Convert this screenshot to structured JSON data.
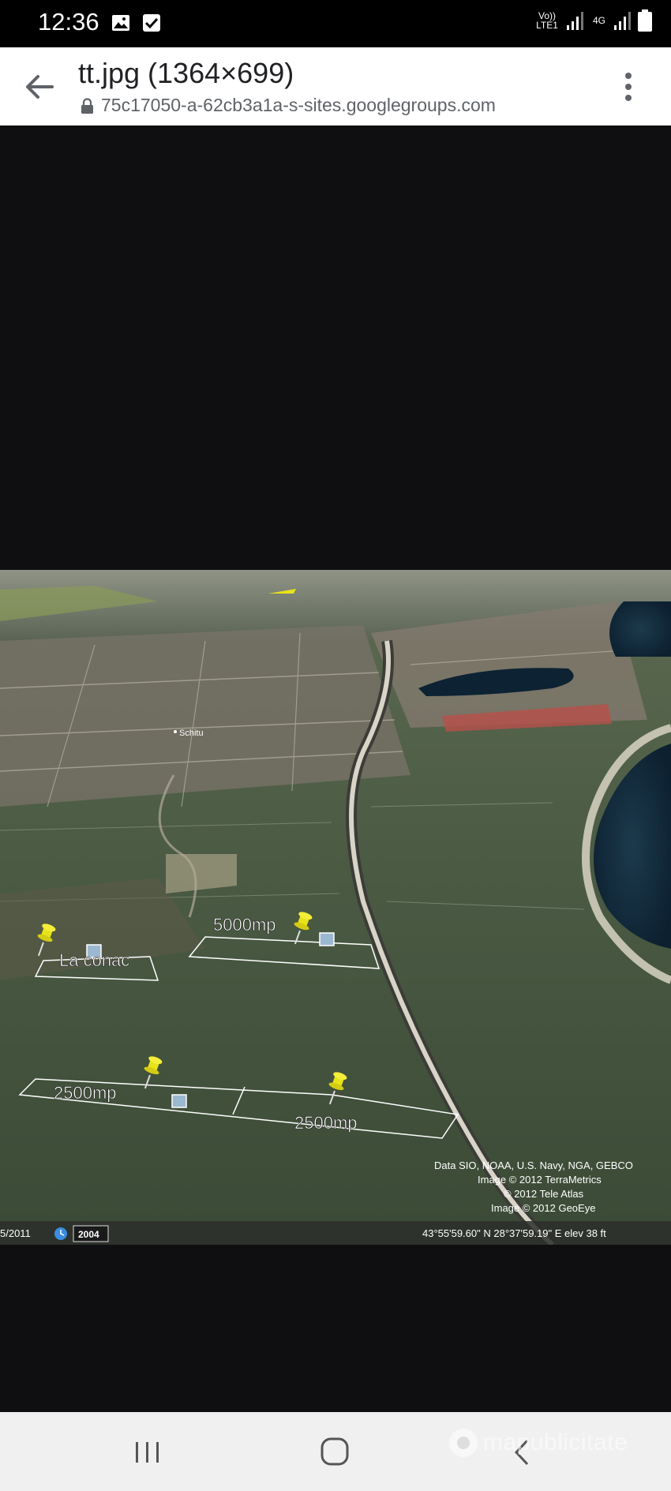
{
  "status_bar": {
    "time": "12:36",
    "network_primary": "Vo)) LTE1",
    "network_secondary": "4G",
    "icons": [
      "gallery-icon",
      "checkbox-icon",
      "signal-icon",
      "battery-icon"
    ]
  },
  "app_bar": {
    "title": "tt.jpg (1364×699)",
    "url": "75c17050-a-62cb3a1a-s-sites.googlegroups.com"
  },
  "map": {
    "place_label": "Schitu",
    "placemarks": [
      {
        "label": "La conac"
      },
      {
        "label": "5000mp"
      },
      {
        "label": "2500mp"
      },
      {
        "label": "2500mp"
      }
    ],
    "attribution": [
      "Data SIO, NOAA, U.S. Navy, NGA, GEBCO",
      "Image © 2012 TerraMetrics",
      "© 2012 Tele Atlas",
      "Image © 2012 GeoEye"
    ],
    "bottom_bar": {
      "date": "5/2011",
      "year_badge": "2004",
      "coords": "43°55'59.60\" N  28°37'59.19\" E  elev  38 ft"
    }
  },
  "watermark": "mapublicitate",
  "colors": {
    "status_bg": "#000000",
    "appbar_bg": "#ffffff",
    "viewer_bg": "#0f0f11",
    "pin_yellow": "#e8e21a",
    "navbar_bg": "#f0f0f0"
  }
}
